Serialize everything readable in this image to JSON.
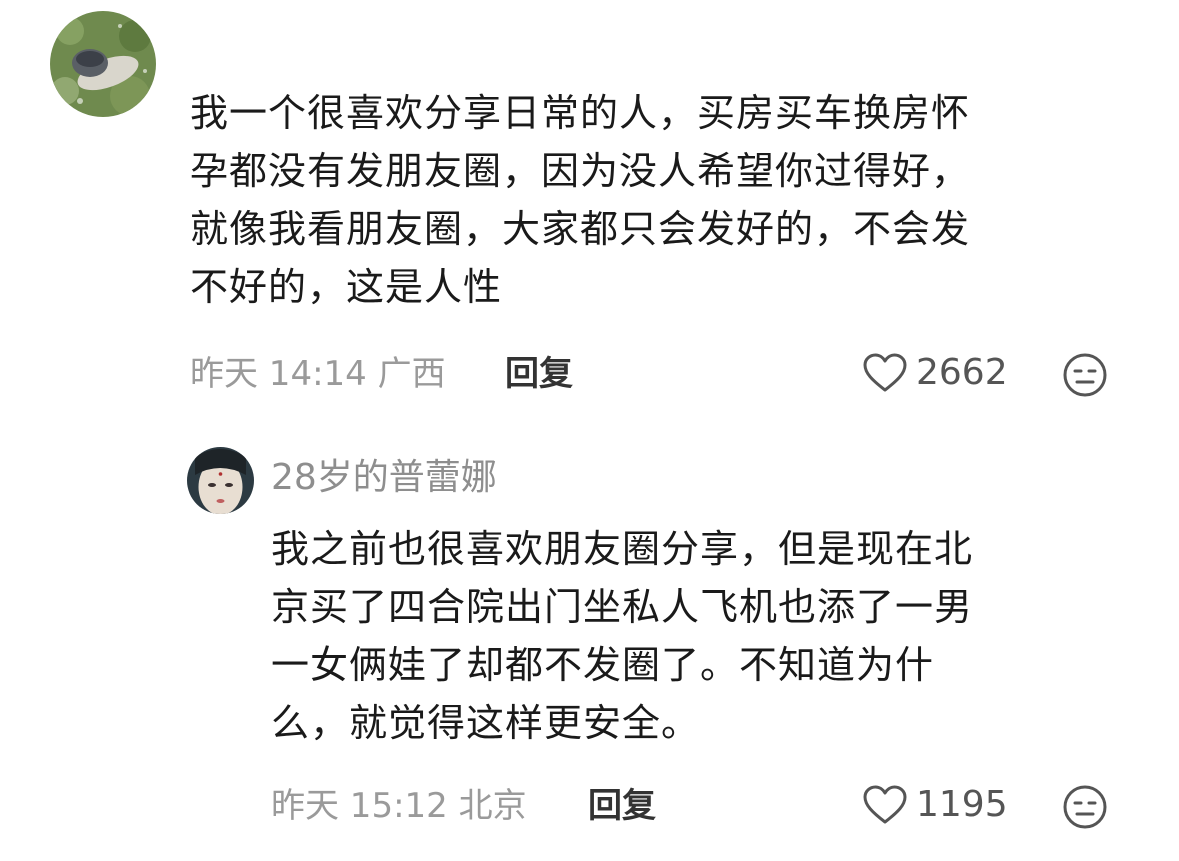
{
  "colors": {
    "text": "#1a1a1a",
    "meta": "#9a9a9a",
    "reply": "#333333",
    "icon": "#555555"
  },
  "comments": [
    {
      "avatar_icon": "avatar-person-lying-on-grass",
      "text": "我一个很喜欢分享日常的人，买房买车换房怀孕都没有发朋友圈，因为没人希望你过得好，就像我看朋友圈，大家都只会发好的，不会发不好的，这是人性",
      "lines": [
        "我一个很喜欢分享日常的人，买房买车换房怀",
        "孕都没有发朋友圈，因为没人希望你过得好，",
        "就像我看朋友圈，大家都只会发好的，不会发",
        "不好的，这是人性"
      ],
      "time": "昨天 14:14",
      "location": "广西",
      "reply_label": "回复",
      "like_icon": "heart-outline-icon",
      "like_count": "2662",
      "dislike_icon": "dislike-face-icon"
    }
  ],
  "replies": [
    {
      "avatar_icon": "avatar-painted-woman-face",
      "username": "28岁的普蕾娜",
      "lines": [
        "我之前也很喜欢朋友圈分享，但是现在北",
        "京买了四合院出门坐私人飞机也添了一男",
        "一女俩娃了却都不发圈了。不知道为什",
        "么，就觉得这样更安全。"
      ],
      "time": "昨天 15:12",
      "location": "北京",
      "reply_label": "回复",
      "like_icon": "heart-outline-icon",
      "like_count": "1195",
      "dislike_icon": "dislike-face-icon"
    }
  ]
}
